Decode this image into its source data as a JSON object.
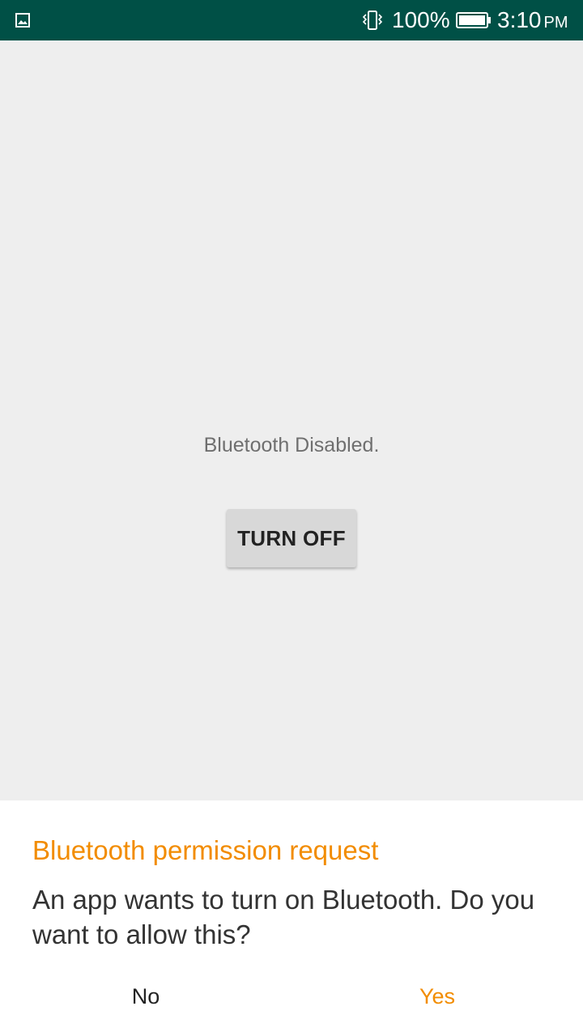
{
  "status_bar": {
    "battery_percent": "100%",
    "time": "3:10",
    "ampm": "PM",
    "icons": [
      "image-notification-icon",
      "vibrate-icon",
      "battery-full-icon"
    ],
    "background_color": "#005046"
  },
  "main": {
    "status_text": "Bluetooth Disabled.",
    "turn_button_label": "TURN OFF"
  },
  "dialog": {
    "title": "Bluetooth permission request",
    "message": "An app wants to turn on Bluetooth. Do you want to allow this?",
    "negative_label": "No",
    "positive_label": "Yes",
    "accent_color": "#f28c00"
  }
}
